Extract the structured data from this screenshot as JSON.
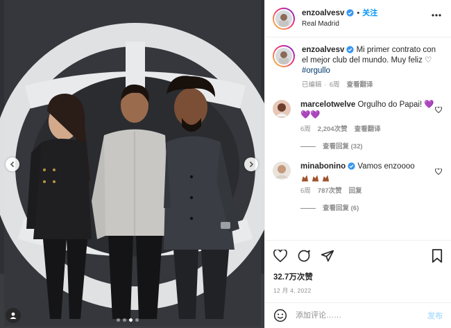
{
  "post": {
    "author": "enzoalvesv",
    "location": "Real Madrid",
    "follow_label": "关注",
    "caption_author": "enzoalvesv",
    "caption_text": "Mi primer contrato con el mejor club del mundo. Muy feliz ♡ ",
    "hashtag": "#orgullo",
    "caption_meta": {
      "edited": "已编辑",
      "dot": "·",
      "age": "6周",
      "translate": "查看翻译"
    }
  },
  "comments": [
    {
      "user": "marcelotwelve",
      "text": "Orgulho do Papai! 💜💜💜",
      "age": "6周",
      "likes": "2,204次赞",
      "translate": "查看翻译",
      "replies": "查看回复 (32)"
    },
    {
      "user": "minabonino",
      "text": "Vamos enzoooo",
      "age": "6周",
      "likes": "787次赞",
      "reply": "回复",
      "replies": "查看回复 (6)"
    }
  ],
  "stats": {
    "likes": "32.7万次赞",
    "date": "12 月 4, 2022"
  },
  "composer": {
    "placeholder": "添加评论……",
    "post_label": "发布"
  },
  "colors": {
    "link": "#0095f6",
    "heart_purple": "#8a5cf6",
    "muted": "#8e8e8e",
    "text": "#262626",
    "photo_bg": "#2b2d31"
  },
  "icons": [
    "more-options-icon",
    "verified-badge-icon",
    "heart-icon",
    "comment-icon",
    "share-icon",
    "bookmark-icon",
    "emoji-icon",
    "tag-user-icon",
    "chevron-left-icon",
    "chevron-right-icon"
  ],
  "carousel": {
    "slides": 4,
    "active_index": 2
  }
}
